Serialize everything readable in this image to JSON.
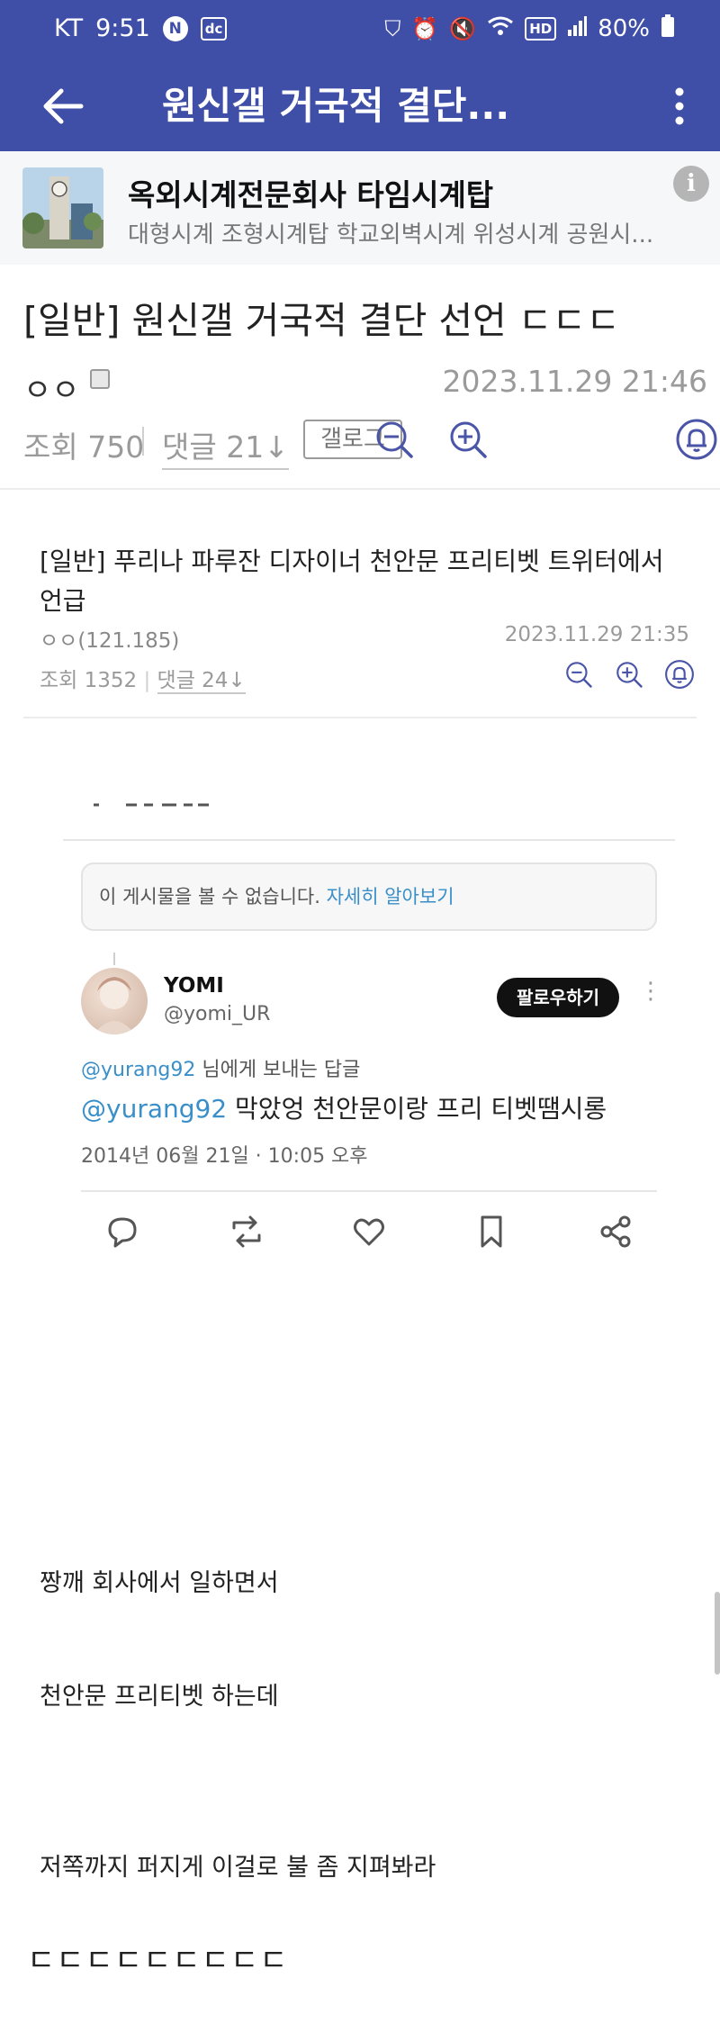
{
  "status_bar": {
    "carrier": "KT",
    "time": "9:51",
    "battery": "80%"
  },
  "app_bar": {
    "title": "원신갤 거국적 결단..."
  },
  "gallery": {
    "name": "옥외시계전문회사 타임시계탑",
    "description": "대형시계 조형시계탑 학교외벽시계 위성시계 공원시...",
    "info_label": "i"
  },
  "post": {
    "title": "[일반] 원신갤 거국적 결단 선언 ㄷㄷㄷ",
    "author": "ㅇㅇ",
    "date": "2023.11.29 21:46",
    "views": "조회 750",
    "comments": "댓글 21↓",
    "gallog_label": "갤로그"
  },
  "related_post": {
    "title": "[일반] 푸리나 파루잔 디자이너 천안문 프리티벳 트위터에서 언급",
    "author": "ㅇㅇ(121.185)",
    "date": "2023.11.29 21:35",
    "views": "조회 1352",
    "comments": "댓글 24↓"
  },
  "tweet": {
    "unavailable_text": "이 게시물을 볼 수 없습니다.",
    "unavailable_link": "자세히 알아보기",
    "name": "YOMI",
    "handle": "@yomi_UR",
    "follow_label": "팔로우하기",
    "reply_mention": "@yurang92",
    "reply_suffix": "님에게 보내는 답글",
    "text_mention": "@yurang92",
    "text_body": "막았엉 천안문이랑 프리 티벳땜시롱",
    "timestamp": "2014년 06월 21일 · 10:05 오후"
  },
  "body_lines": [
    "짱깨 회사에서 일하면서",
    "천안문 프리티벳 하는데",
    "저쪽까지 퍼지게 이걸로 불 좀 지펴봐라"
  ],
  "closing_line": "ㄷㄷㄷㄷㄷㄷㄷㄷㄷ",
  "colors": {
    "header_bg": "#3f4fa8",
    "accent_icon": "#4a55a8",
    "link_blue": "#3a8fc9"
  }
}
